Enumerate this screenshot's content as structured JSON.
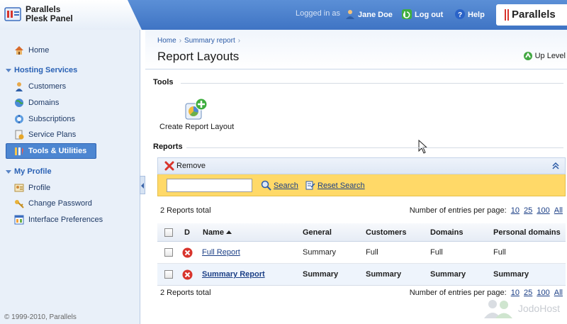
{
  "header": {
    "logo_line1": "Parallels",
    "logo_line2": "Plesk Panel",
    "logged_in_as": "Logged in as",
    "user_name": "Jane Doe",
    "logout_label": "Log out",
    "help_label": "Help",
    "brand": "Parallels"
  },
  "sidebar": {
    "home": "Home",
    "hosting_section": "Hosting Services",
    "hosting_items": [
      "Customers",
      "Domains",
      "Subscriptions",
      "Service Plans",
      "Tools & Utilities"
    ],
    "profile_section": "My Profile",
    "profile_items": [
      "Profile",
      "Change Password",
      "Interface Preferences"
    ],
    "copyright": "© 1999-2010, Parallels"
  },
  "main": {
    "breadcrumb": [
      "Home",
      "Summary report"
    ],
    "page_title": "Report Layouts",
    "up_level": "Up Level",
    "tools_heading": "Tools",
    "create_report_layout": "Create Report Layout",
    "reports_heading": "Reports",
    "remove_label": "Remove",
    "search_placeholder": "",
    "search_label": "Search",
    "reset_search_label": "Reset Search",
    "total_top": "2 Reports total",
    "total_bottom": "2 Reports total",
    "per_page_label": "Number of entries per page:",
    "per_page_options": [
      "10",
      "25",
      "100",
      "All"
    ]
  },
  "table": {
    "columns": [
      "D",
      "Name",
      "General",
      "Customers",
      "Domains",
      "Personal domains"
    ],
    "rows": [
      {
        "name": "Full Report",
        "general": "Summary",
        "customers": "Full",
        "domains": "Full",
        "personal": "Full"
      },
      {
        "name": "Summary Report",
        "general": "Summary",
        "customers": "Summary",
        "domains": "Summary",
        "personal": "Summary"
      }
    ]
  },
  "watermark": "JodoHost",
  "colors": {
    "header_blue": "#3f74c4",
    "sidebar_bg": "#e9f0f9",
    "active_item": "#4d86d1",
    "search_bar": "#ffd968",
    "link": "#1b3f86"
  }
}
